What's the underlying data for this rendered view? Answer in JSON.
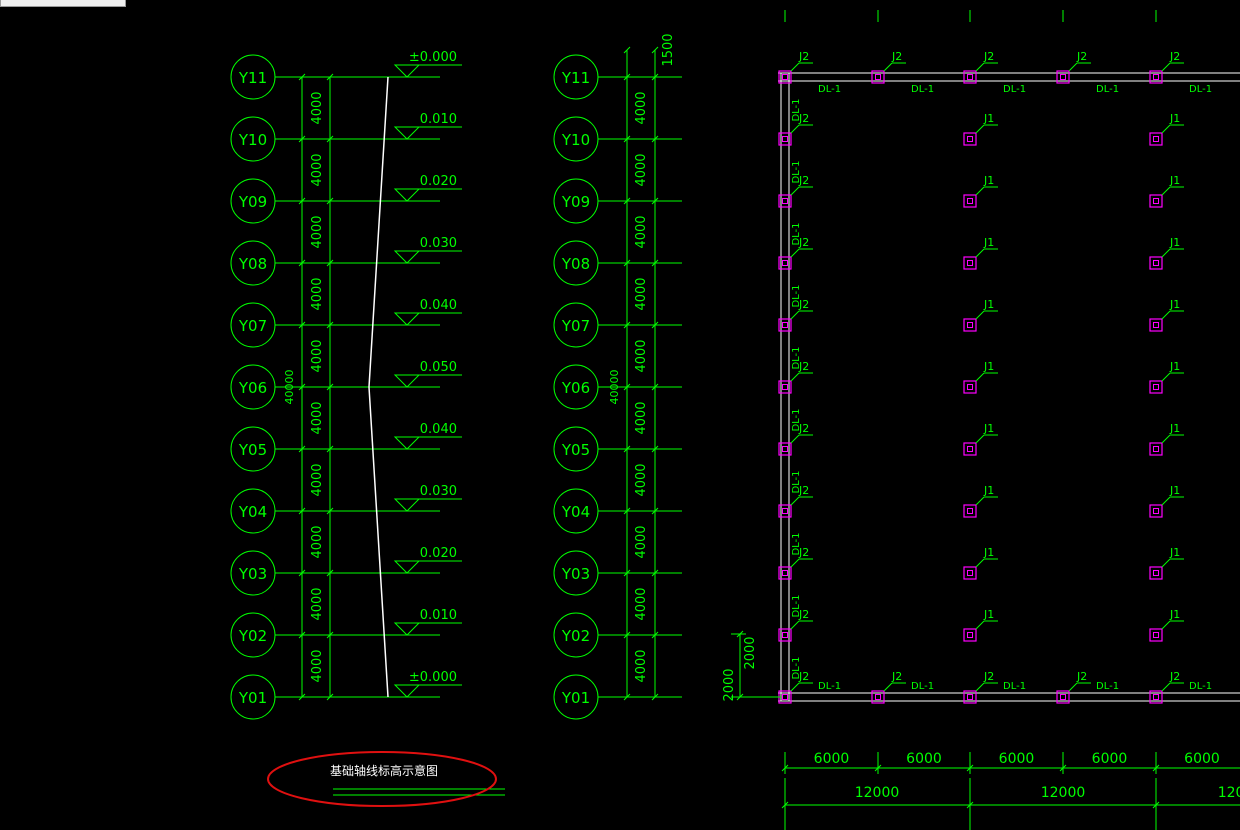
{
  "tab": {
    "label": ""
  },
  "colors": {
    "background": "#000000",
    "line": "#00ff00",
    "slope": "#ffffff",
    "column": "#ff00ff",
    "highlight": "#e01010"
  },
  "elevation_diagram": {
    "axes": [
      "Y11",
      "Y10",
      "Y09",
      "Y08",
      "Y07",
      "Y06",
      "Y05",
      "Y04",
      "Y03",
      "Y02",
      "Y01"
    ],
    "spacing_label": "4000",
    "overall_label": "40000",
    "elevations": [
      "±0.000",
      "0.010",
      "0.020",
      "0.030",
      "0.040",
      "0.050",
      "0.040",
      "0.030",
      "0.020",
      "0.010",
      "±0.000"
    ],
    "caption": "基础轴线标高示意图"
  },
  "axis_diagram": {
    "axes": [
      "Y11",
      "Y10",
      "Y09",
      "Y08",
      "Y07",
      "Y06",
      "Y05",
      "Y04",
      "Y03",
      "Y02",
      "Y01"
    ],
    "spacing_label": "4000",
    "overall_label": "40000",
    "top_dimension": "1500"
  },
  "foundation_plan": {
    "corner_label": "J2",
    "interior_label": "J1",
    "beam_label": "DL-1",
    "edge_dimension": "2000",
    "bay_dimension": "6000",
    "span_dimension": "12000"
  }
}
